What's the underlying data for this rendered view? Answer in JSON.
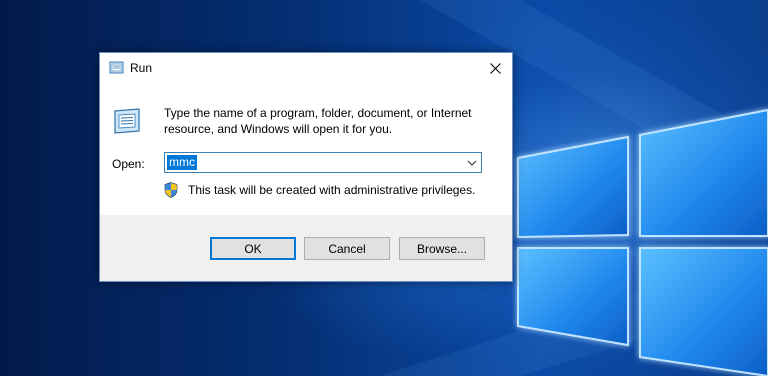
{
  "dialog": {
    "title": "Run",
    "close_icon": "close-icon",
    "run_icon": "run-icon",
    "description": "Type the name of a program, folder, document, or Internet resource, and Windows will open it for you.",
    "open_label": "Open:",
    "open_value": "mmc",
    "dropdown_icon": "chevron-down-icon",
    "admin_icon": "uac-shield-icon",
    "admin_note": "This task will be created with administrative privileges.",
    "buttons": {
      "ok": "OK",
      "cancel": "Cancel",
      "browse": "Browse..."
    }
  },
  "colors": {
    "accent": "#0078d7",
    "desktop": "#053076"
  }
}
